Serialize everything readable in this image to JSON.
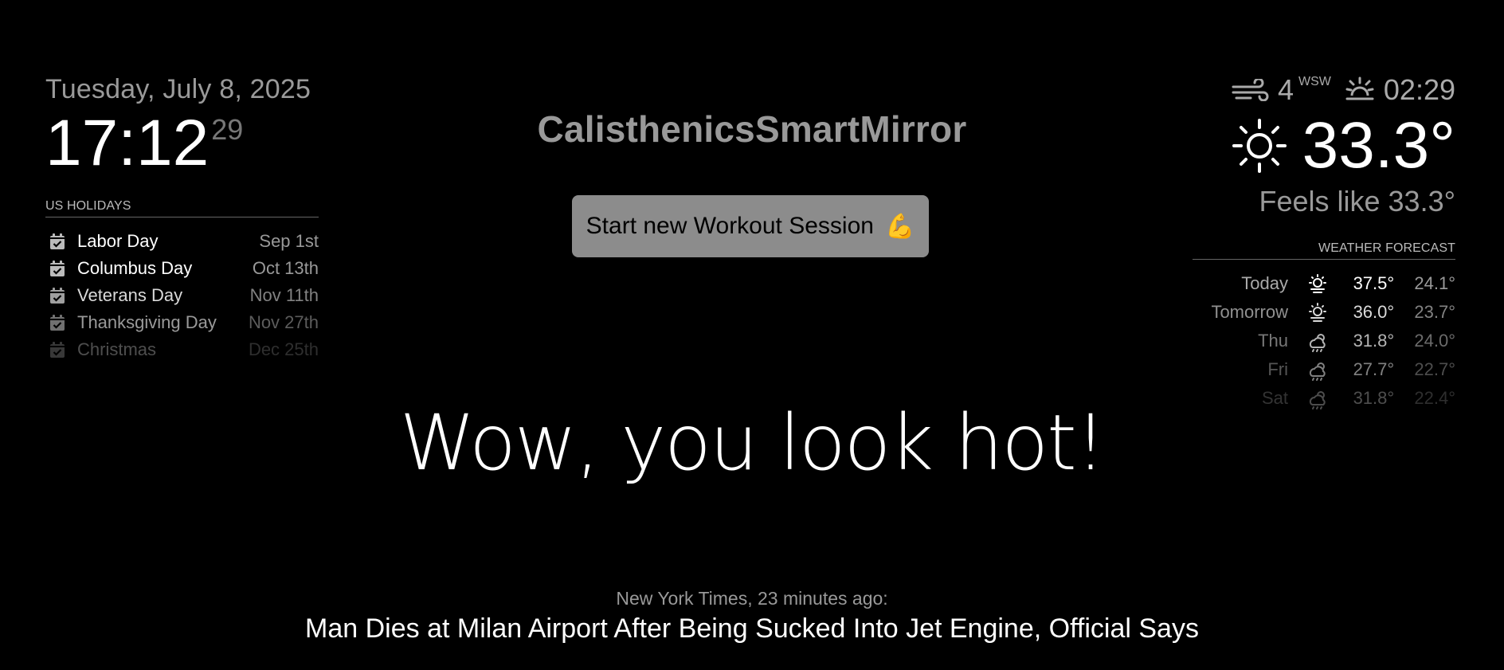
{
  "clock": {
    "date": "Tuesday, July 8, 2025",
    "time": "17:12",
    "seconds": "29"
  },
  "holidays": {
    "header": "US Holidays",
    "icon": "calendar-check-icon",
    "items": [
      {
        "name": "Labor Day",
        "date": "Sep 1st"
      },
      {
        "name": "Columbus Day",
        "date": "Oct 13th"
      },
      {
        "name": "Veterans Day",
        "date": "Nov 11th"
      },
      {
        "name": "Thanksgiving Day",
        "date": "Nov 27th"
      },
      {
        "name": "Christmas",
        "date": "Dec 25th"
      }
    ]
  },
  "app": {
    "title": "CalisthenicsSmartMirror",
    "workout_button_label": "Start new Workout Session",
    "workout_button_emoji": "💪"
  },
  "compliment": "Wow, you look hot!",
  "news": {
    "source": "New York Times, 23 minutes ago:",
    "headline": "Man Dies at Milan Airport After Being Sucked Into Jet Engine, Official Says"
  },
  "current_weather": {
    "wind_icon": "wind-icon",
    "wind_speed": "4",
    "wind_direction": "WSW",
    "sun_icon": "sunset-icon",
    "sun_time": "02:29",
    "condition_icon": "sun-icon",
    "temperature": "33.3°",
    "feels_like": "Feels like 33.3°"
  },
  "forecast": {
    "header": "Weather Forecast",
    "days": [
      {
        "day": "Today",
        "icon": "hazy-sun-icon",
        "max": "37.5°",
        "min": "24.1°"
      },
      {
        "day": "Tomorrow",
        "icon": "hazy-sun-icon",
        "max": "36.0°",
        "min": "23.7°"
      },
      {
        "day": "Thu",
        "icon": "cloudy-rain-icon",
        "max": "31.8°",
        "min": "24.0°"
      },
      {
        "day": "Fri",
        "icon": "cloudy-rain-icon",
        "max": "27.7°",
        "min": "22.7°"
      },
      {
        "day": "Sat",
        "icon": "cloudy-rain-icon",
        "max": "31.8°",
        "min": "22.4°"
      }
    ]
  },
  "colors": {
    "background": "#000000",
    "primary_text": "#ffffff",
    "secondary_text": "#999999",
    "button_background": "#8c8c8c"
  }
}
